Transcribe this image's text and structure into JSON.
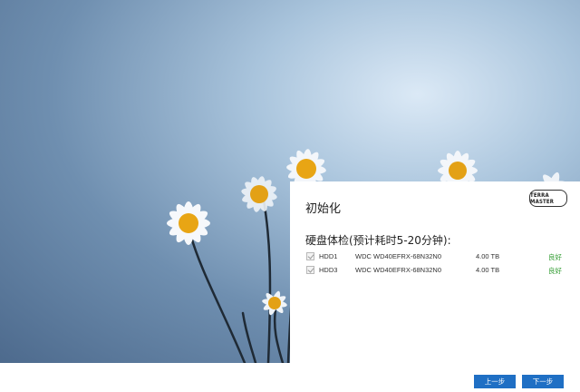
{
  "panel": {
    "title": "初始化",
    "logo_text": "TERRA MASTER",
    "section_heading": "硬盘体检(预计耗时5-20分钟):"
  },
  "disks": [
    {
      "name": "HDD1",
      "model": "WDC WD40EFRX-68N32N0",
      "size": "4.00 TB",
      "status": "良好",
      "checked": true
    },
    {
      "name": "HDD3",
      "model": "WDC WD40EFRX-68N32N0",
      "size": "4.00 TB",
      "status": "良好",
      "checked": true
    }
  ],
  "footer": {
    "prev_label": "上一步",
    "next_label": "下一步"
  },
  "colors": {
    "button": "#1f6fc4",
    "status_good": "#2e9a2e"
  }
}
